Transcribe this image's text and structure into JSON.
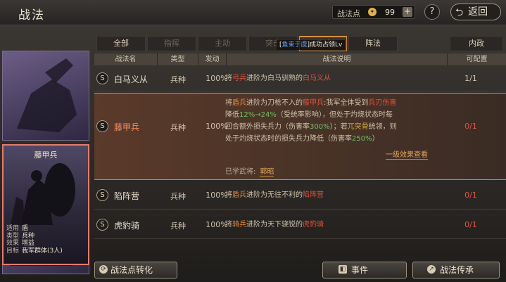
{
  "header": {
    "title": "战法",
    "points_label": "战法点",
    "points_value": "99",
    "plus": "+",
    "help": "?",
    "back": "返回"
  },
  "tabs": [
    "全部",
    "指挥",
    "主动",
    "突击",
    "兵种",
    "阵法",
    "内政"
  ],
  "tooltip": {
    "prefix": "[",
    "name": "鱼束于虞",
    "suffix": "]成功占领Lv"
  },
  "table": {
    "headers": [
      "战法名",
      "类型",
      "发动",
      "战法说明",
      "可配置"
    ],
    "rows": [
      {
        "badge": "S",
        "name": "白马义从",
        "type": "兵种",
        "act": "100%",
        "desc": [
          "将",
          "弓兵",
          "进阶为白马驯熟的",
          "白马义从"
        ],
        "conf": "1/1"
      },
      {
        "badge": "S",
        "name": "藤甲兵",
        "type": "兵种",
        "act": "100%",
        "desc_lines": [
          [
            "将",
            "盾兵",
            "进阶为刀枪不入的",
            "藤甲兵",
            ":我军全体受到",
            "兵刃伤害"
          ],
          [
            "降低",
            "12%→24%",
            "（受统率影响），但处于灼烧状态时每"
          ],
          [
            "回合额外损失兵力（伤害率",
            "300%",
            "）；若",
            "兀突骨",
            "统领，则"
          ],
          [
            "处于灼烧状态时的损失兵力降低（伤害率",
            "250%",
            "）"
          ]
        ],
        "more": "一级效果查看",
        "learned_label": "已学武将:",
        "learned_name": "郭昭",
        "conf": "0/1"
      },
      {
        "badge": "S",
        "name": "陷阵营",
        "type": "兵种",
        "act": "100%",
        "desc": [
          "将",
          "盾兵",
          "进阶为无往不利的",
          "陷阵营"
        ],
        "conf": "0/1"
      },
      {
        "badge": "S",
        "name": "虎豹骑",
        "type": "兵种",
        "act": "100%",
        "desc": [
          "将",
          "骑兵",
          "进阶为天下骁锐的",
          "虎豹骑"
        ],
        "conf": "0/1"
      }
    ]
  },
  "card": {
    "name": "藤甲兵",
    "info": [
      {
        "k": "适用",
        "v": "盾"
      },
      {
        "k": "类型",
        "v": "兵种"
      },
      {
        "k": "效果",
        "v": "增益"
      },
      {
        "k": "目标",
        "v": "我军群体(3人)"
      }
    ]
  },
  "footer": {
    "convert": "战法点转化",
    "event": "事件",
    "inherit": "战法传承"
  }
}
